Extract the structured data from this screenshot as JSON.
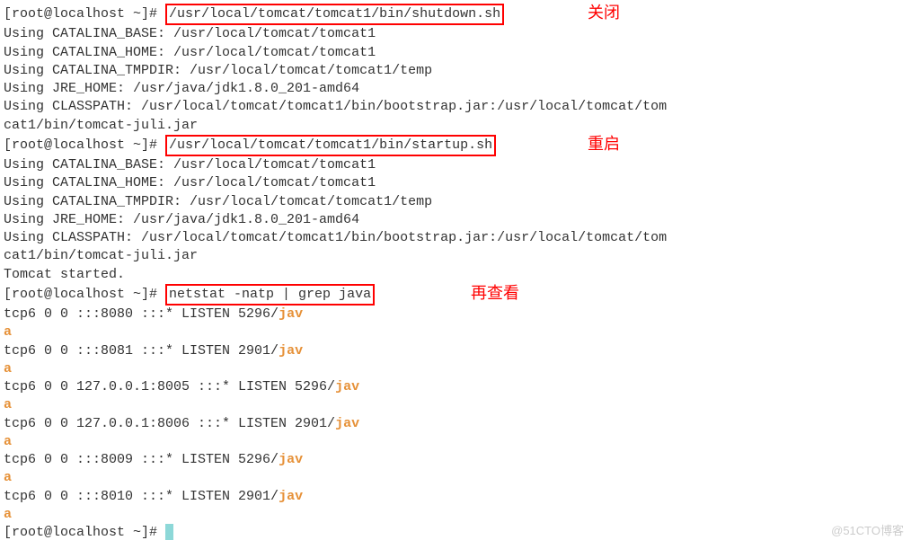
{
  "prompt": "[root@localhost ~]# ",
  "commands": {
    "shutdown": "/usr/local/tomcat/tomcat1/bin/shutdown.sh",
    "startup": "/usr/local/tomcat/tomcat1/bin/startup.sh",
    "netstat": "netstat -natp | grep java"
  },
  "annotations": {
    "shutdown": "关闭",
    "startup": "重启",
    "netstat": "再查看"
  },
  "env_output1": [
    "Using CATALINA_BASE:   /usr/local/tomcat/tomcat1",
    "Using CATALINA_HOME:   /usr/local/tomcat/tomcat1",
    "Using CATALINA_TMPDIR: /usr/local/tomcat/tomcat1/temp",
    "Using JRE_HOME:        /usr/java/jdk1.8.0_201-amd64",
    "Using CLASSPATH:       /usr/local/tomcat/tomcat1/bin/bootstrap.jar:/usr/local/tomcat/tom",
    "cat1/bin/tomcat-juli.jar"
  ],
  "env_output2": [
    "Using CATALINA_BASE:   /usr/local/tomcat/tomcat1",
    "Using CATALINA_HOME:   /usr/local/tomcat/tomcat1",
    "Using CATALINA_TMPDIR: /usr/local/tomcat/tomcat1/temp",
    "Using JRE_HOME:        /usr/java/jdk1.8.0_201-amd64",
    "Using CLASSPATH:       /usr/local/tomcat/tomcat1/bin/bootstrap.jar:/usr/local/tomcat/tom",
    "cat1/bin/tomcat-juli.jar",
    "Tomcat started."
  ],
  "netstat_rows": [
    {
      "proto": "tcp6",
      "recv": "0",
      "send": "0",
      "local": ":::8080",
      "foreign": ":::*",
      "state": "LISTEN",
      "pid": "5296/",
      "prog": "jav",
      "wrap": "a"
    },
    {
      "proto": "tcp6",
      "recv": "0",
      "send": "0",
      "local": ":::8081",
      "foreign": ":::*",
      "state": "LISTEN",
      "pid": "2901/",
      "prog": "jav",
      "wrap": "a"
    },
    {
      "proto": "tcp6",
      "recv": "0",
      "send": "0",
      "local": "127.0.0.1:8005",
      "foreign": ":::*",
      "state": "LISTEN",
      "pid": "5296/",
      "prog": "jav",
      "wrap": "a"
    },
    {
      "proto": "tcp6",
      "recv": "0",
      "send": "0",
      "local": "127.0.0.1:8006",
      "foreign": ":::*",
      "state": "LISTEN",
      "pid": "2901/",
      "prog": "jav",
      "wrap": "a"
    },
    {
      "proto": "tcp6",
      "recv": "0",
      "send": "0",
      "local": ":::8009",
      "foreign": ":::*",
      "state": "LISTEN",
      "pid": "5296/",
      "prog": "jav",
      "wrap": "a"
    },
    {
      "proto": "tcp6",
      "recv": "0",
      "send": "0",
      "local": ":::8010",
      "foreign": ":::*",
      "state": "LISTEN",
      "pid": "2901/",
      "prog": "jav",
      "wrap": "a"
    }
  ],
  "watermark": "@51CTO博客"
}
